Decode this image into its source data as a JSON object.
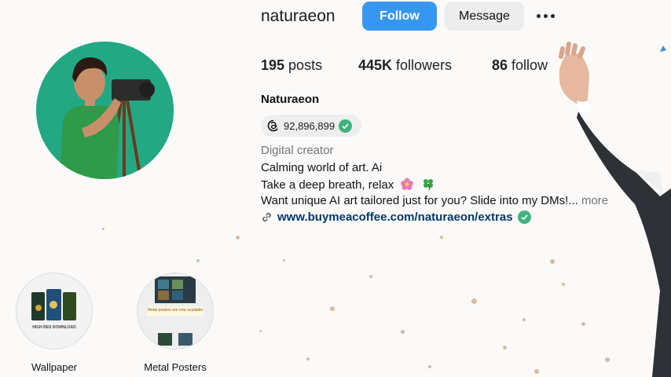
{
  "profile": {
    "username": "naturaeon",
    "full_name": "Naturaeon",
    "threads_count": "92,896,899",
    "category": "Digital creator",
    "bio_lines": [
      "Calming world of art. Ai",
      "Take a deep breath, relax",
      "Want unique AI art tailored just for you? Slide into my DMs!..."
    ],
    "bio_more": " more",
    "link": "www.buymeacoffee.com/naturaeon/extras"
  },
  "actions": {
    "follow": "Follow",
    "message": "Message"
  },
  "stats": {
    "posts": {
      "value": "195",
      "label": " posts"
    },
    "followers": {
      "value": "445K",
      "label": " followers"
    },
    "following": {
      "value": "86",
      "label": " following"
    }
  },
  "highlights": [
    {
      "label": "Wallpaper",
      "caption": "HIGH RES DOWNLOAD"
    },
    {
      "label": "Metal Posters",
      "caption": "Metal posters are now available"
    }
  ],
  "colors": {
    "follow_blue": "#3797f0",
    "verified_green": "#3fb27f",
    "avatar_bg": "#23a884"
  },
  "icons": [
    "more-options-icon",
    "threads-icon",
    "verified-icon",
    "link-icon",
    "flower-emoji",
    "clover-emoji"
  ]
}
